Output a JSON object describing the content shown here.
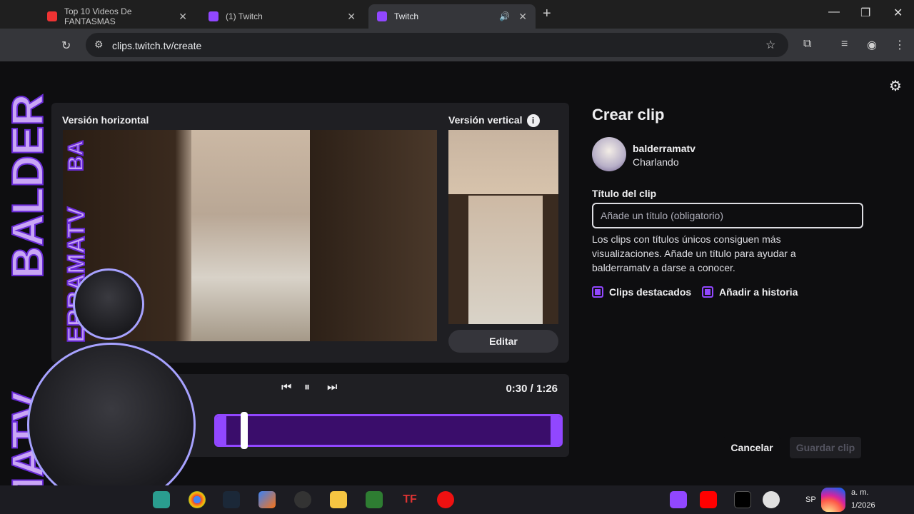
{
  "browser": {
    "tabs": [
      {
        "label": "Top 10 Videos De FANTASMAS",
        "active": false,
        "favicon": "youtube-icon"
      },
      {
        "label": "(1) Twitch",
        "active": false,
        "favicon": "twitch-icon"
      },
      {
        "label": "Twitch",
        "active": true,
        "favicon": "twitch-icon"
      }
    ],
    "new_tab": "+",
    "url": "clips.twitch.tv/create"
  },
  "clip_editor": {
    "horizontal_label": "Versión horizontal",
    "vertical_label": "Versión vertical",
    "info_icon": "i",
    "edit_label": "Editar",
    "time_display": "0:30 / 1:26",
    "progress": 0.35
  },
  "form": {
    "title": "Crear clip",
    "channel": "balderramatv",
    "category": "Charlando",
    "title_label": "Título del clip",
    "title_placeholder": "Añade un título (obligatorio)",
    "title_value": "",
    "help_text": "Los clips con títulos únicos consiguen más visualizaciones. Añade un título para ayudar a balderramatv a darse a conocer.",
    "checkbox_featured": "Clips destacados",
    "checkbox_story": "Añadir a historia",
    "cancel_label": "Cancelar",
    "save_label": "Guardar clip"
  },
  "overlay": {
    "watermark_left": "BALDER",
    "watermark_left2": "MATV",
    "watermark_video": "ERRAMATV",
    "watermark_video2": "BA"
  },
  "taskbar": {
    "tray_time": "a. m.",
    "tray_date": "1/2026",
    "tray_lang": "SP"
  },
  "colors": {
    "accent": "#9147ff",
    "bg": "#0e0e10",
    "panel": "#1f1f23"
  }
}
